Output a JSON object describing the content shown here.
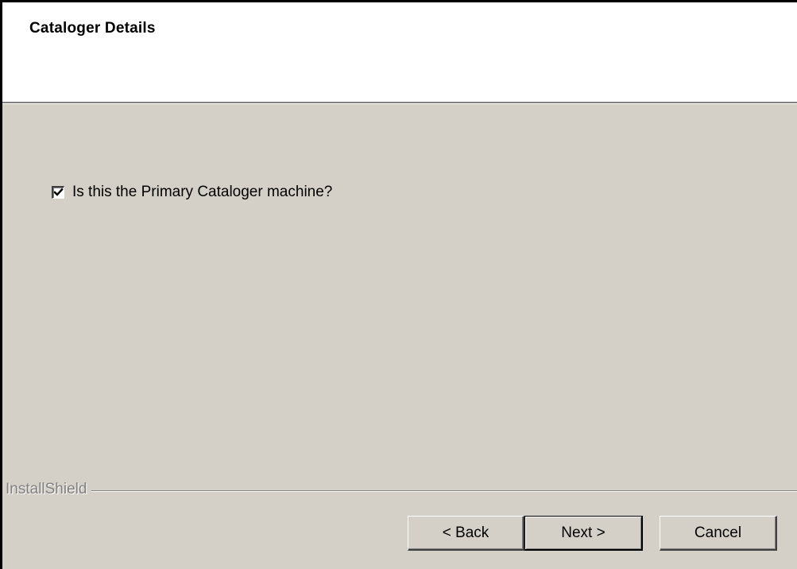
{
  "header": {
    "title": "Cataloger Details"
  },
  "options": {
    "primary_cataloger": {
      "label": "Is this the Primary Cataloger machine?",
      "checked": true
    }
  },
  "branding": {
    "text": "InstallShield"
  },
  "buttons": {
    "back": "< Back",
    "next": "Next >",
    "cancel": "Cancel"
  },
  "colors": {
    "dialog_background": "#d4d0c8",
    "header_background": "#ffffff",
    "branding_text": "#808080"
  },
  "icons": {
    "checkbox_mark": "check-icon"
  }
}
